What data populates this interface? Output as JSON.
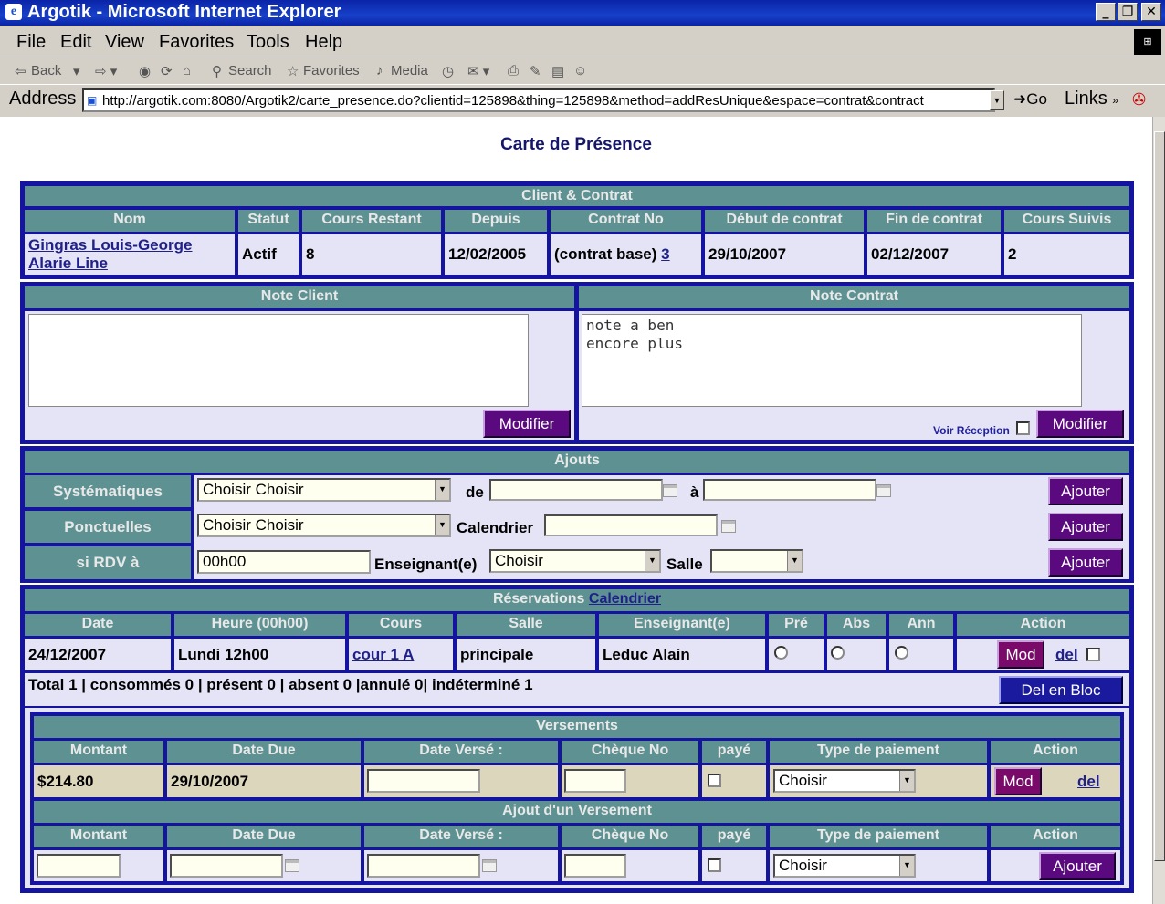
{
  "window": {
    "title": "Argotik - Microsoft Internet Explorer"
  },
  "menu": [
    "File",
    "Edit",
    "View",
    "Favorites",
    "Tools",
    "Help"
  ],
  "toolbar": {
    "back": "Back",
    "search": "Search",
    "favorites": "Favorites",
    "media": "Media"
  },
  "address": {
    "label": "Address",
    "url": "http://argotik.com:8080/Argotik2/carte_presence.do?clientid=125898&thing=125898&method=addResUnique&espace=contrat&contract",
    "go": "Go",
    "links": "Links"
  },
  "page": {
    "title": "Carte de Présence"
  },
  "client_contrat": {
    "header": "Client & Contrat",
    "columns": [
      "Nom",
      "Statut",
      "Cours Restant",
      "Depuis",
      "Contrat No",
      "Début de contrat",
      "Fin de contrat",
      "Cours Suivis"
    ],
    "nom1": "Gingras Louis-George",
    "nom2": "Alarie Line",
    "statut": "Actif",
    "cours_restant": "8",
    "depuis": "12/02/2005",
    "contrat_prefix": "(contrat base)",
    "contrat_no": "3",
    "debut": "29/10/2007",
    "fin": "02/12/2007",
    "cours_suivis": "2"
  },
  "notes": {
    "client_header": "Note Client",
    "contrat_header": "Note Contrat",
    "client_text": "",
    "contrat_text": "note a ben\nencore plus",
    "modifier": "Modifier",
    "voir_reception": "Voir Réception"
  },
  "ajouts": {
    "header": "Ajouts",
    "systematiques": "Systématiques",
    "ponctuelles": "Ponctuelles",
    "rdv": "si RDV à",
    "choisir_choisir": "Choisir Choisir",
    "de": "de",
    "a": "à",
    "calendrier": "Calendrier",
    "heure": "00h00",
    "enseignant": "Enseignant(e)",
    "choisir": "Choisir",
    "salle": "Salle",
    "ajouter": "Ajouter"
  },
  "reservations": {
    "header": "Réservations",
    "header_link": "Calendrier",
    "columns": [
      "Date",
      "Heure (00h00)",
      "Cours",
      "Salle",
      "Enseignant(e)",
      "Pré",
      "Abs",
      "Ann",
      "Action"
    ],
    "row": {
      "date": "24/12/2007",
      "heure": "Lundi 12h00",
      "cours": "cour 1 A",
      "salle": "principale",
      "enseignant": "Leduc Alain",
      "mod": "Mod",
      "del": "del"
    },
    "total": "Total 1 | consommés 0 | présent 0 | absent 0 |annulé 0| indéterminé 1",
    "del_bloc": "Del en Bloc"
  },
  "versements": {
    "header": "Versements",
    "columns": [
      "Montant",
      "Date Due",
      "Date Versé :",
      "Chèque No",
      "payé",
      "Type de paiement",
      "Action"
    ],
    "row": {
      "montant": "$214.80",
      "date_due": "29/10/2007",
      "type": "Choisir",
      "mod": "Mod",
      "del": "del"
    },
    "ajout_header": "Ajout d'un Versement",
    "ajout_type": "Choisir",
    "ajouter": "Ajouter"
  }
}
